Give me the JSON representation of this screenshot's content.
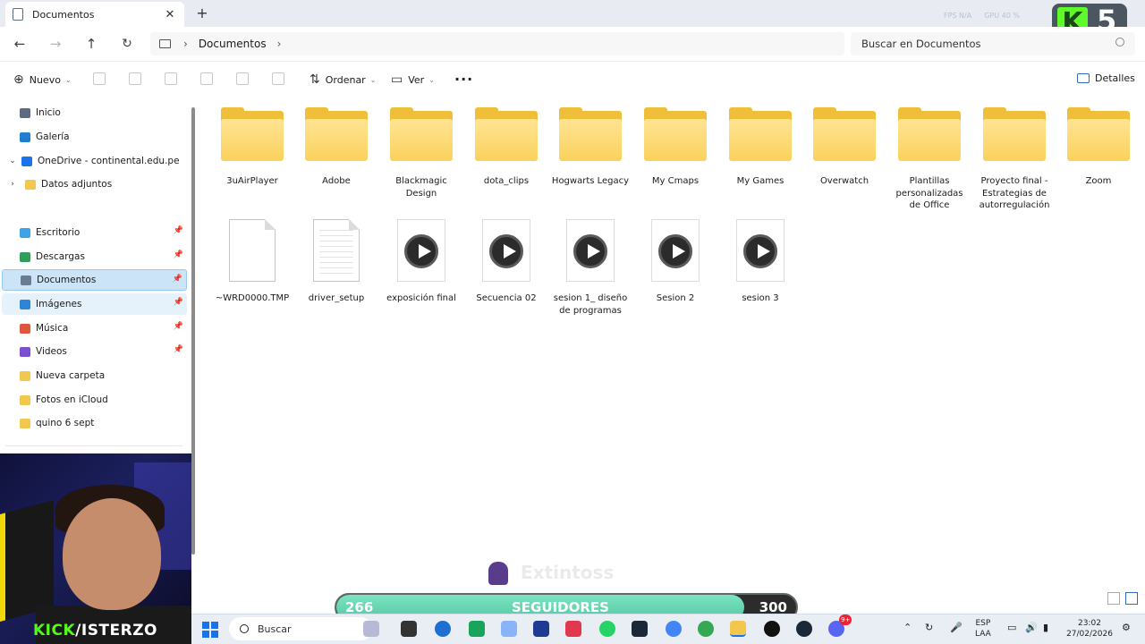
{
  "window": {
    "tab_title": "Documentos",
    "close_glyph": "✕",
    "new_tab_glyph": "+"
  },
  "overlay": {
    "fps": "FPS N/A",
    "gpu": "GPU 40 %",
    "kick_number": "5"
  },
  "address": {
    "crumbs": [
      "Documentos"
    ],
    "search_placeholder": "Buscar en Documentos"
  },
  "commands": {
    "nuevo": "Nuevo",
    "ordenar": "Ordenar",
    "ver": "Ver",
    "detalles": "Detalles"
  },
  "sidebar": {
    "items": [
      {
        "label": "Inicio",
        "icon": "home-icon",
        "color": "#5a6b82"
      },
      {
        "label": "Galería",
        "icon": "gallery-icon",
        "color": "#1f7ecf"
      },
      {
        "label": "OneDrive - continental.edu.pe",
        "icon": "onedrive-icon",
        "color": "#1a73e8"
      },
      {
        "label": "Datos adjuntos",
        "icon": "folder-icon",
        "color": "#f3c64e"
      },
      {
        "label": "Escritorio",
        "icon": "desktop-icon",
        "color": "#3fa3e8"
      },
      {
        "label": "Descargas",
        "icon": "download-icon",
        "color": "#2e9e5a"
      },
      {
        "label": "Documentos",
        "icon": "documents-icon",
        "color": "#6b7b93"
      },
      {
        "label": "Imágenes",
        "icon": "images-icon",
        "color": "#2c85d8"
      },
      {
        "label": "Música",
        "icon": "music-icon",
        "color": "#e0533e"
      },
      {
        "label": "Videos",
        "icon": "videos-icon",
        "color": "#7a4fd1"
      },
      {
        "label": "Nueva carpeta",
        "icon": "folder-icon",
        "color": "#f3c64e"
      },
      {
        "label": "Fotos en iCloud",
        "icon": "folder-icon",
        "color": "#f3c64e"
      },
      {
        "label": "quino 6 sept",
        "icon": "folder-icon",
        "color": "#f3c64e"
      }
    ]
  },
  "files": {
    "folders": [
      [
        "3uAirPlayer"
      ],
      [
        "Adobe"
      ],
      [
        "Blackmagic",
        "Design"
      ],
      [
        "dota_clips"
      ],
      [
        "Hogwarts Legacy"
      ],
      [
        "My Cmaps"
      ],
      [
        "My Games"
      ],
      [
        "Overwatch"
      ],
      [
        "Plantillas",
        "personalizadas",
        "de Office"
      ],
      [
        "Proyecto final -",
        "Estrategias de",
        "autorregulación"
      ],
      [
        "Zoom"
      ]
    ],
    "files": [
      {
        "lines": [
          "~WRD0000.TMP"
        ],
        "kind": "blank"
      },
      {
        "lines": [
          "driver_setup"
        ],
        "kind": "text"
      },
      {
        "lines": [
          "exposición final"
        ],
        "kind": "video"
      },
      {
        "lines": [
          "Secuencia 02"
        ],
        "kind": "video"
      },
      {
        "lines": [
          "sesion 1_ diseño",
          "de programas"
        ],
        "kind": "video"
      },
      {
        "lines": [
          "Sesion 2"
        ],
        "kind": "video"
      },
      {
        "lines": [
          "sesion 3"
        ],
        "kind": "video"
      }
    ]
  },
  "stream": {
    "kick_tag_prefix": "KICK",
    "kick_tag_name": "/ISTERZO",
    "ninja_name": "Extintoss",
    "followers_current": "266",
    "followers_label": "SEGUIDORES",
    "followers_goal": "300",
    "followers_progress": 0.887
  },
  "taskbar": {
    "search_label": "Buscar",
    "lang_line1": "ESP",
    "lang_line2": "LAA",
    "time": "23:02",
    "date": "27/02/2026",
    "discord_badge": "9+"
  }
}
